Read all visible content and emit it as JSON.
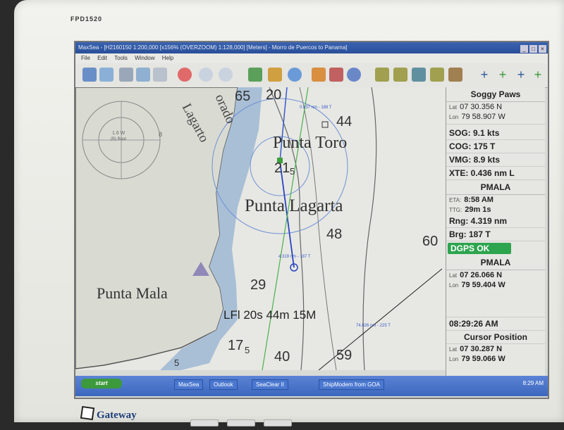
{
  "monitor": {
    "model": "FPD1520",
    "brand": "Gateway"
  },
  "window": {
    "title": "MaxSea - [H2160150 1:200,000 [x156% (OVERZOOM) 1:128,000] [Meters] - Morro de Puercos to Panama]",
    "menu": [
      "File",
      "Edit",
      "Tools",
      "Window",
      "Help"
    ]
  },
  "chart": {
    "labels": {
      "punta_toro": "Punta Toro",
      "punta_lagarta": "Punta Lagarta",
      "punta_mala": "Punta Mala",
      "lagarto": "Lagarto",
      "colorado": "orado",
      "light": "LFl 20s 44m 15M",
      "compass_var": "1.6 W",
      "compass_sub": "(B) Boat"
    },
    "soundings": [
      "65",
      "20",
      "44",
      "21",
      "5",
      "48",
      "60",
      "29",
      "17",
      "5",
      "40",
      "59",
      "5",
      "8"
    ],
    "route_labels": {
      "leg1": "0.637 nm - 188 T",
      "leg2": "4.319 nm - 187 T",
      "leg3": "74.826 nm - 225 T"
    }
  },
  "panel": {
    "vessel": "Soggy Paws",
    "lat_label": "Lat",
    "lon_label": "Lon",
    "vessel_lat": "07 30.356 N",
    "vessel_lon": "79 58.907 W",
    "sog": "SOG: 9.1 kts",
    "cog": "COG: 175 T",
    "vmg": "VMG: 8.9 kts",
    "xte": "XTE: 0.436 nm L",
    "waypoint": "PMALA",
    "eta_label": "ETA:",
    "eta": "8:58 AM",
    "ttg_label": "TTG:",
    "ttg": "29m 1s",
    "rng": "Rng: 4.319 nm",
    "brg": "Brg: 187 T",
    "gps_status": "DGPS OK",
    "wp_name": "PMALA",
    "wp_lat": "07 26.066 N",
    "wp_lon": "79 59.404 W",
    "time": "08:29:26 AM",
    "cursor_title": "Cursor Position",
    "cursor_lat": "07 30.287 N",
    "cursor_lon": "79 59.066 W"
  },
  "taskbar": {
    "start": "start",
    "tasks": [
      "MaxSea",
      "Outlook",
      "SeaClear II",
      "ShipModem from GOA"
    ],
    "clock": "8:29 AM"
  }
}
